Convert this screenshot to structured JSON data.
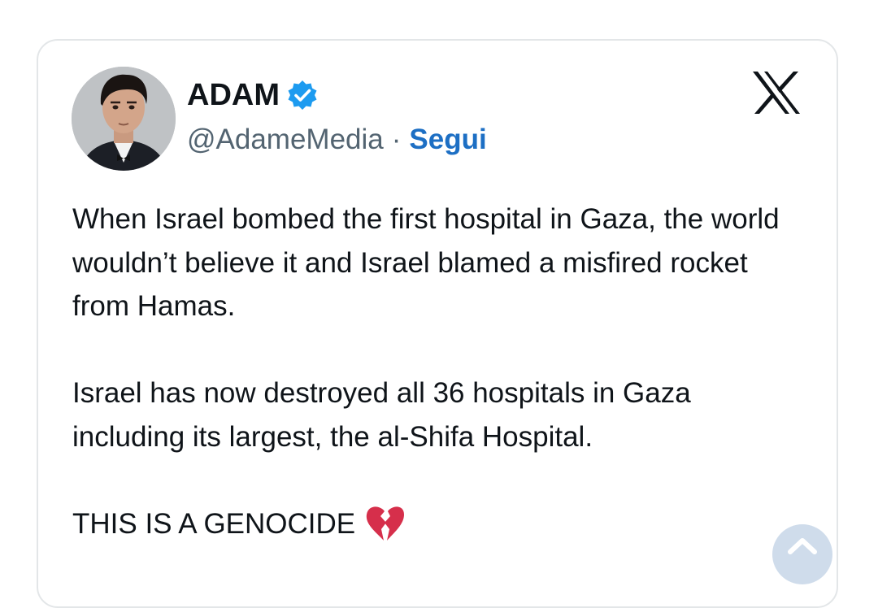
{
  "tweet": {
    "author": {
      "display_name": "ADAM",
      "handle": "@AdameMedia",
      "separator": "·",
      "follow_label": "Segui",
      "verified": true
    },
    "paragraphs": [
      "When Israel bombed the first hospital in Gaza, the world wouldn’t believe it and Israel blamed a misfired rocket from Hamas.",
      "Israel has now destroyed all 36 hospitals in Gaza including its largest, the al-Shifa Hospital."
    ],
    "closing_line": "THIS IS A GENOCIDE"
  },
  "icons": {
    "verified": "verified-badge-icon",
    "platform": "x-logo-icon",
    "emoji": "broken-heart-icon",
    "scroll": "scroll-up-icon"
  },
  "colors": {
    "text": "#0f1419",
    "secondary_text": "#536471",
    "follow_link": "#1d6fc4",
    "verified_badge": "#1d9bf0",
    "card_border": "#e3e6e8",
    "broken_heart": "#d62f4b"
  }
}
